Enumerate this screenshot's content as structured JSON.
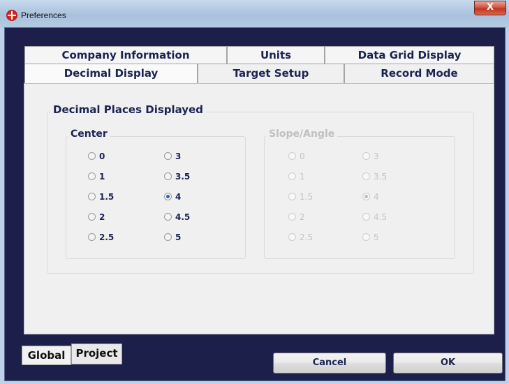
{
  "window": {
    "title": "Preferences",
    "close_label": "X"
  },
  "tabs_row1": [
    {
      "label": "Company Information"
    },
    {
      "label": "Units"
    },
    {
      "label": "Data Grid Display"
    }
  ],
  "tabs_row2": [
    {
      "label": "Decimal Display",
      "active": true
    },
    {
      "label": "Target Setup"
    },
    {
      "label": "Record Mode"
    }
  ],
  "group": {
    "title": "Decimal Places Displayed",
    "center": {
      "title": "Center",
      "options": [
        "0",
        "3",
        "1",
        "3.5",
        "1.5",
        "4",
        "2",
        "4.5",
        "2.5",
        "5"
      ],
      "selected": "4",
      "enabled": true
    },
    "slope": {
      "title": "Slope/Angle",
      "options": [
        "0",
        "3",
        "1",
        "3.5",
        "1.5",
        "4",
        "2",
        "4.5",
        "2.5",
        "5"
      ],
      "selected": "4",
      "enabled": false
    }
  },
  "bottom_tabs": [
    {
      "label": "Global",
      "active": true
    },
    {
      "label": "Project"
    }
  ],
  "buttons": {
    "cancel": "Cancel",
    "ok": "OK"
  },
  "colors": {
    "label_text": "#1b2352",
    "client_bg": "#1c1f4a",
    "disabled_text": "#c4c4c4",
    "radio_selected": "#2b64c3"
  }
}
